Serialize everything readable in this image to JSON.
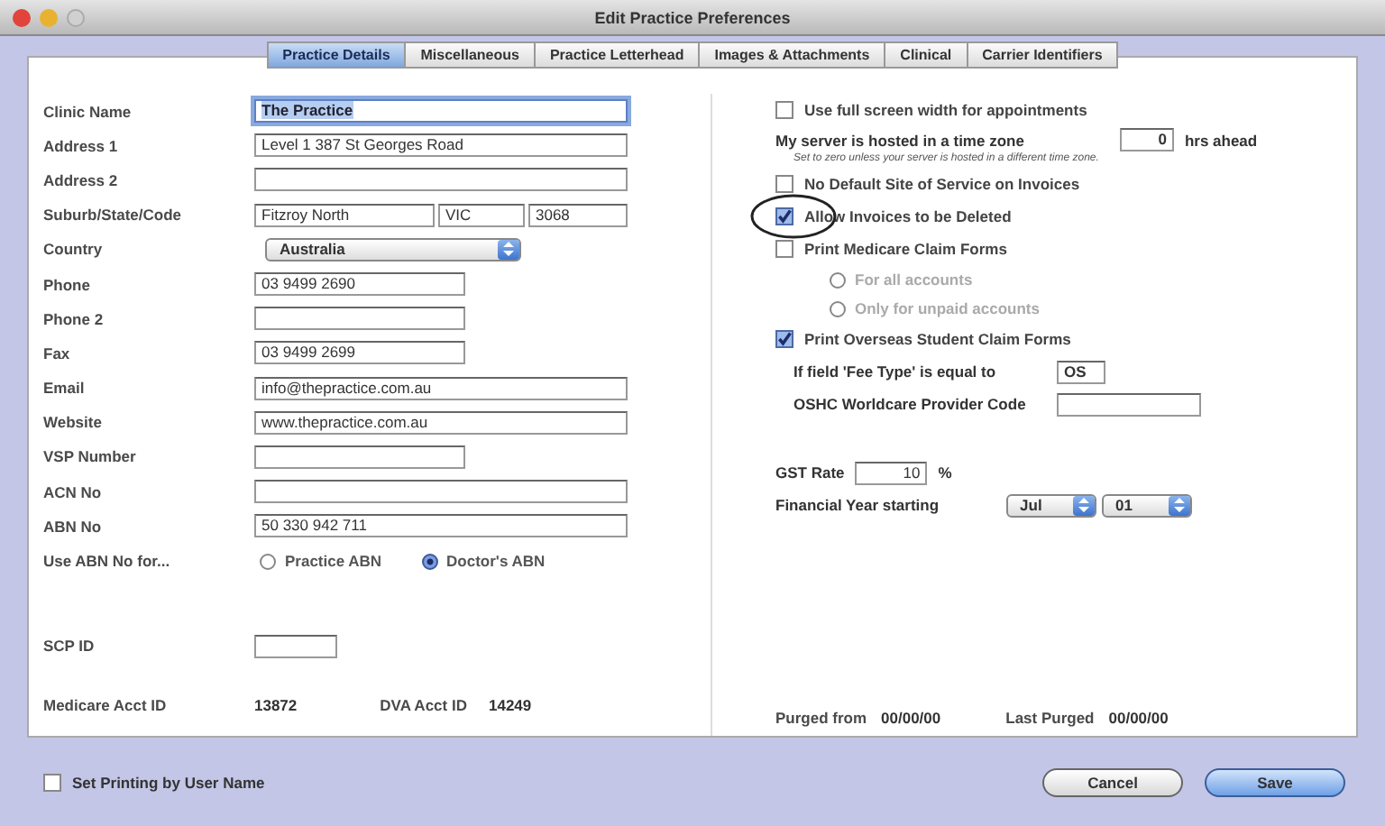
{
  "window": {
    "title": "Edit Practice Preferences"
  },
  "tabs": [
    {
      "label": "Practice Details",
      "selected": true
    },
    {
      "label": "Miscellaneous",
      "selected": false
    },
    {
      "label": "Practice Letterhead",
      "selected": false
    },
    {
      "label": "Images & Attachments",
      "selected": false
    },
    {
      "label": "Clinical",
      "selected": false
    },
    {
      "label": "Carrier Identifiers",
      "selected": false
    }
  ],
  "left_fields": [
    {
      "label": "Clinic Name",
      "kind": "wide",
      "value": "The Practice",
      "focused": true
    },
    {
      "label": "Address 1",
      "kind": "wide",
      "value": "Level 1 387 St Georges Road",
      "focused": false
    },
    {
      "label": "Address 2",
      "kind": "wide",
      "focused": false
    },
    {
      "label": "Suburb/State/Code",
      "kind": "address",
      "values": [
        "Fitzroy North",
        "VIC",
        "3068"
      ]
    },
    {
      "label": "Country",
      "kind": "select",
      "value": "Australia"
    },
    {
      "label": "Phone",
      "kind": "medium",
      "value": "03 9499 2690",
      "focused": false
    },
    {
      "label": "Phone 2",
      "kind": "medium",
      "focused": false
    },
    {
      "label": "Fax",
      "kind": "medium",
      "value": "03 9499 2699",
      "focused": false
    },
    {
      "label": "Email",
      "kind": "wide",
      "value": "info@thepractice.com.au",
      "focused": false
    },
    {
      "label": "Website",
      "kind": "wide",
      "value": "www.thepractice.com.au",
      "focused": false
    },
    {
      "label": "VSP Number",
      "kind": "medium",
      "focused": false
    },
    {
      "label": "ACN No",
      "kind": "wide",
      "focused": false
    },
    {
      "label": "ABN No",
      "kind": "wide",
      "value": "50 330 942 711",
      "focused": false
    },
    {
      "label": "Use ABN No for...",
      "kind": "radio",
      "options": [
        {
          "label": "Practice ABN",
          "selected": false
        },
        {
          "label": "Doctor's ABN",
          "selected": true
        }
      ]
    },
    {
      "label": "SCP ID",
      "kind": "small",
      "focused": false
    }
  ],
  "accounts": [
    {
      "label": "Medicare Acct ID",
      "value": "13872"
    },
    {
      "label": "DVA Acct ID",
      "value": "14249"
    }
  ],
  "right_options": [
    {
      "kind": "checkbox",
      "label": "Use full screen width for appointments",
      "checked": false
    },
    {
      "kind": "timezone",
      "label": "My server is hosted in a time zone",
      "value": "0",
      "suffix": "hrs ahead",
      "note": "Set to zero unless your server is hosted in a different time zone."
    },
    {
      "kind": "checkbox",
      "label": "No Default Site of Service on Invoices",
      "checked": false
    },
    {
      "kind": "checkbox",
      "label": "Allow Invoices to be Deleted",
      "checked": true,
      "circled": true
    },
    {
      "kind": "checkbox",
      "label": "Print Medicare Claim Forms",
      "checked": false
    },
    {
      "kind": "radios",
      "disabled": true,
      "options": [
        {
          "label": "For all accounts",
          "selected": false
        },
        {
          "label": "Only for unpaid accounts",
          "selected": false
        }
      ]
    },
    {
      "kind": "checkbox",
      "label": "Print Overseas Student Claim Forms",
      "checked": true
    },
    {
      "kind": "short_field",
      "label": "If field 'Fee Type' is equal to",
      "value": "OS"
    },
    {
      "kind": "field",
      "label": "OSHC Worldcare Provider Code"
    },
    {
      "kind": "rate",
      "label": "GST Rate",
      "value": "10",
      "suffix": "%"
    },
    {
      "kind": "selects",
      "label": "Financial Year starting",
      "values": [
        "Jul",
        "01"
      ]
    }
  ],
  "purge": [
    {
      "label": "Purged from",
      "value": "00/00/00"
    },
    {
      "label": "Last Purged",
      "value": "00/00/00"
    }
  ],
  "footer": {
    "checkbox": {
      "label": "Set Printing by User Name",
      "checked": false
    },
    "buttons": [
      {
        "label": "Cancel",
        "default": false
      },
      {
        "label": "Save",
        "default": true
      }
    ]
  }
}
